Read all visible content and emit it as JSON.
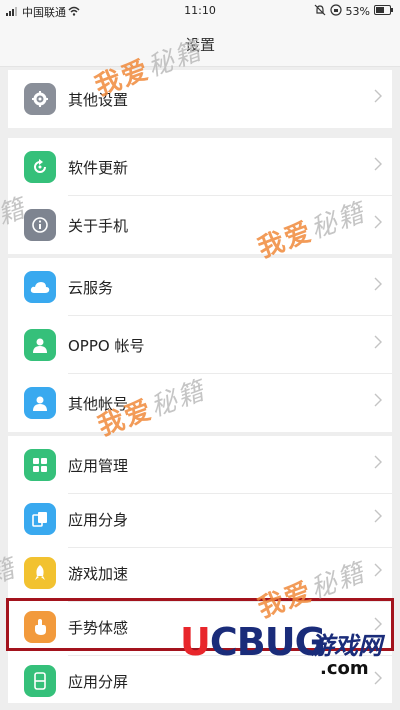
{
  "status": {
    "carrier": "中国联通",
    "time": "11:10",
    "battery": "53%"
  },
  "header": {
    "title": "设置"
  },
  "groups": [
    {
      "items": [
        {
          "label": "其他设置",
          "icon": "gear-icon",
          "color": "#8a8f99"
        }
      ]
    },
    {
      "items": [
        {
          "label": "软件更新",
          "icon": "refresh-icon",
          "color": "#35c07a"
        },
        {
          "label": "关于手机",
          "icon": "info-icon",
          "color": "#7e8490"
        }
      ]
    },
    {
      "items": [
        {
          "label": "云服务",
          "icon": "cloud-icon",
          "color": "#39a9ef"
        },
        {
          "label": "OPPO 帐号",
          "icon": "person-icon",
          "color": "#35c07a"
        },
        {
          "label": "其他帐号",
          "icon": "person-icon",
          "color": "#39a9ef"
        }
      ]
    },
    {
      "items": [
        {
          "label": "应用管理",
          "icon": "grid-icon",
          "color": "#35c07a"
        },
        {
          "label": "应用分身",
          "icon": "clone-icon",
          "color": "#39a9ef"
        },
        {
          "label": "游戏加速",
          "icon": "rocket-icon",
          "color": "#f2c230"
        },
        {
          "label": "手势体感",
          "icon": "hand-icon",
          "color": "#f29a3c"
        },
        {
          "label": "应用分屏",
          "icon": "split-screen-icon",
          "color": "#35c07a"
        }
      ]
    }
  ],
  "watermark": {
    "part1": "我爱",
    "part2": "秘籍"
  },
  "brand": {
    "name_red": "U",
    "name_blue": "CBUG",
    "cn": "游戏网",
    "domain": ".com"
  }
}
